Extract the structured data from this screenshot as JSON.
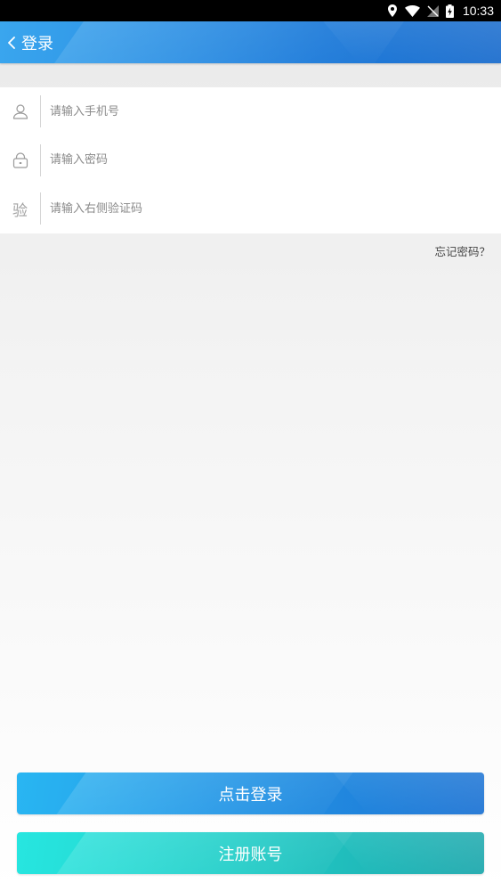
{
  "status_bar": {
    "time": "10:33",
    "icons": [
      "location-icon",
      "wifi-icon",
      "no-sim-icon",
      "battery-charging-icon"
    ]
  },
  "app_bar": {
    "title": "登录",
    "back_icon": "chevron-left-icon"
  },
  "form": {
    "phone": {
      "icon": "user-icon",
      "placeholder": "请输入手机号",
      "value": ""
    },
    "password": {
      "icon": "lock-icon",
      "placeholder": "请输入密码",
      "value": ""
    },
    "captcha": {
      "icon_glyph": "验",
      "placeholder": "请输入右侧验证码",
      "value": ""
    }
  },
  "forgot_password": "忘记密码？",
  "buttons": {
    "login": "点击登录",
    "register": "注册账号"
  },
  "colors": {
    "app_bar": "#2a8fe4",
    "login_button": "#2396e6",
    "register_button": "#22cfc9"
  }
}
